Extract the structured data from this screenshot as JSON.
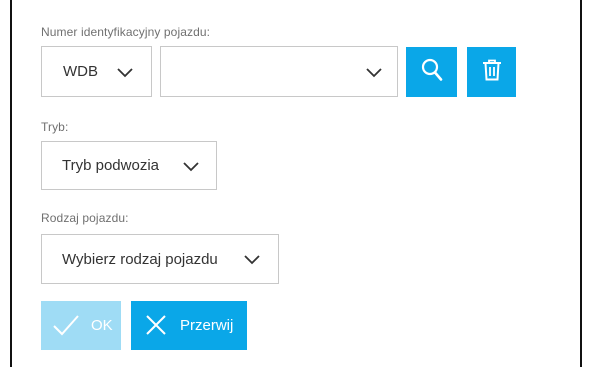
{
  "vin": {
    "label": "Numer identyfikacyjny pojazdu:",
    "prefix_value": "WDB",
    "value": "",
    "search_icon": "search-icon",
    "delete_icon": "trash-icon"
  },
  "mode": {
    "label": "Tryb:",
    "value": "Tryb podwozia"
  },
  "vehicle_type": {
    "label": "Rodzaj pojazdu:",
    "value": "Wybierz rodzaj pojazdu"
  },
  "actions": {
    "ok_label": "OK",
    "cancel_label": "Przerwij"
  },
  "colors": {
    "accent": "#0aa7e8",
    "accent_disabled": "#9fdcf5",
    "border": "#c8c8c8",
    "label": "#707070"
  }
}
